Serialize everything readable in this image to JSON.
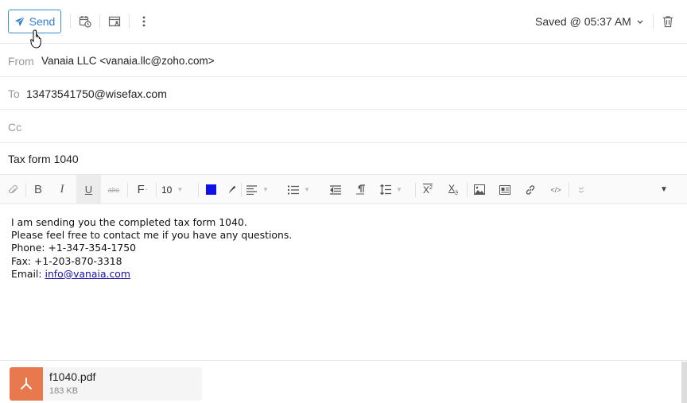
{
  "toolbar": {
    "send_label": "Send",
    "saved_status": "Saved @ 05:37 AM",
    "icons": [
      "send-icon",
      "schedule-icon",
      "template-icon",
      "more-icon",
      "chevron-down-icon",
      "trash-icon"
    ]
  },
  "headers": {
    "from_label": "From",
    "from_value": "Vanaia LLC <vanaia.llc@zoho.com>",
    "to_label": "To",
    "to_value": "13473541750@wisefax.com",
    "cc_label": "Cc",
    "cc_value": "",
    "subject": "Tax form 1040"
  },
  "format_bar": {
    "bold": "B",
    "italic": "I",
    "underline": "U",
    "strikethrough": "abc",
    "font_family": "F",
    "font_size": "10",
    "text_color": "#1010e8"
  },
  "body": {
    "lines": [
      "I am sending you the completed tax form 1040.",
      "Please feel free to contact me if you have any questions.",
      "Phone: +1-347-354-1750",
      "Fax: +1-203-870-3318"
    ],
    "email_label": "Email: ",
    "email_link": "info@vanaia.com"
  },
  "attachment": {
    "filename": "f1040.pdf",
    "size": "183 KB",
    "color": "#e8784d"
  }
}
